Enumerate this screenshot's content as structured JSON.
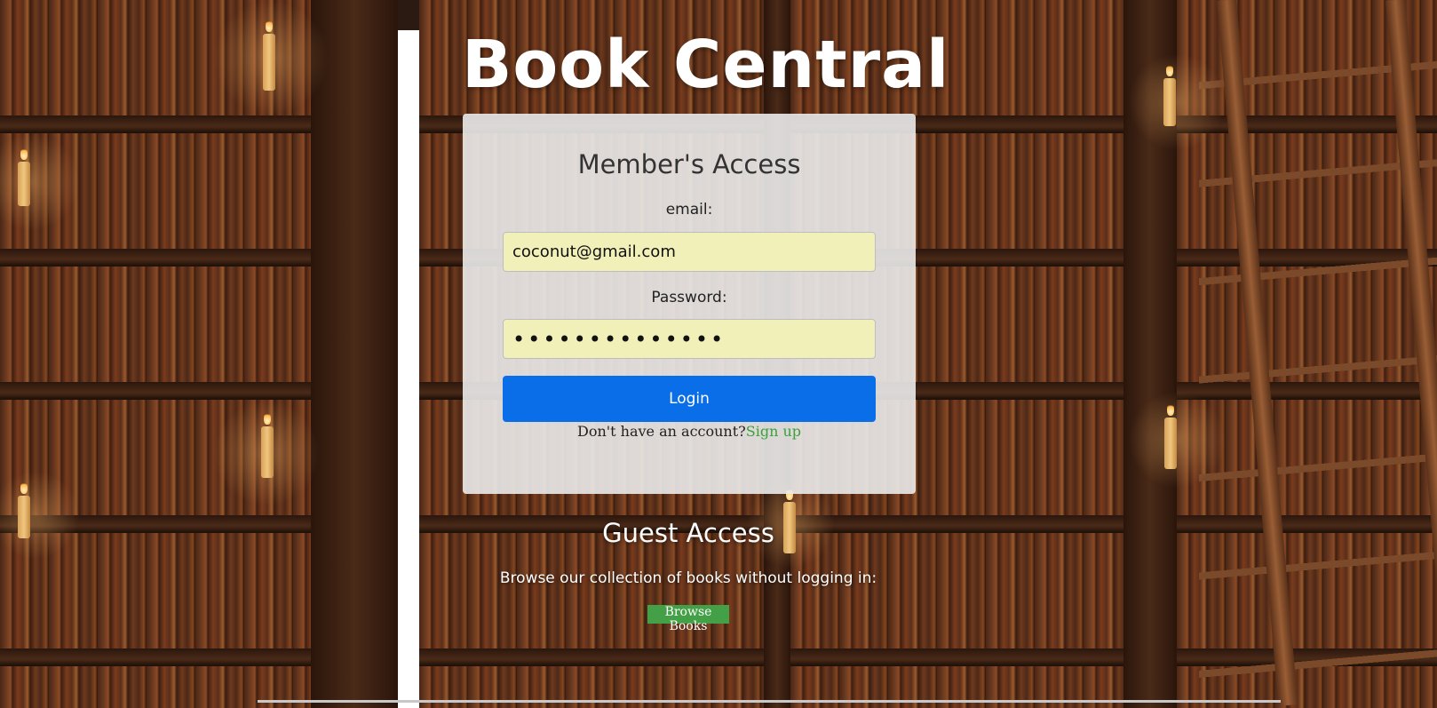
{
  "header": {
    "title": "Book Central"
  },
  "member_access": {
    "title": "Member's Access",
    "email_label": "email:",
    "email_value": "coconut@gmail.com",
    "password_label": "Password:",
    "password_value": "••••••••••••••",
    "login_label": "Login",
    "no_account_text": "Don't have an account?",
    "signup_label": "Sign up"
  },
  "guest_access": {
    "title": "Guest Access",
    "description": "Browse our collection of books without logging in:",
    "browse_label": "Browse Books"
  },
  "colors": {
    "login_button": "#0a6ee8",
    "browse_button": "#43a047",
    "signup_link": "#3aa03a",
    "input_background": "#f0f0b8"
  }
}
